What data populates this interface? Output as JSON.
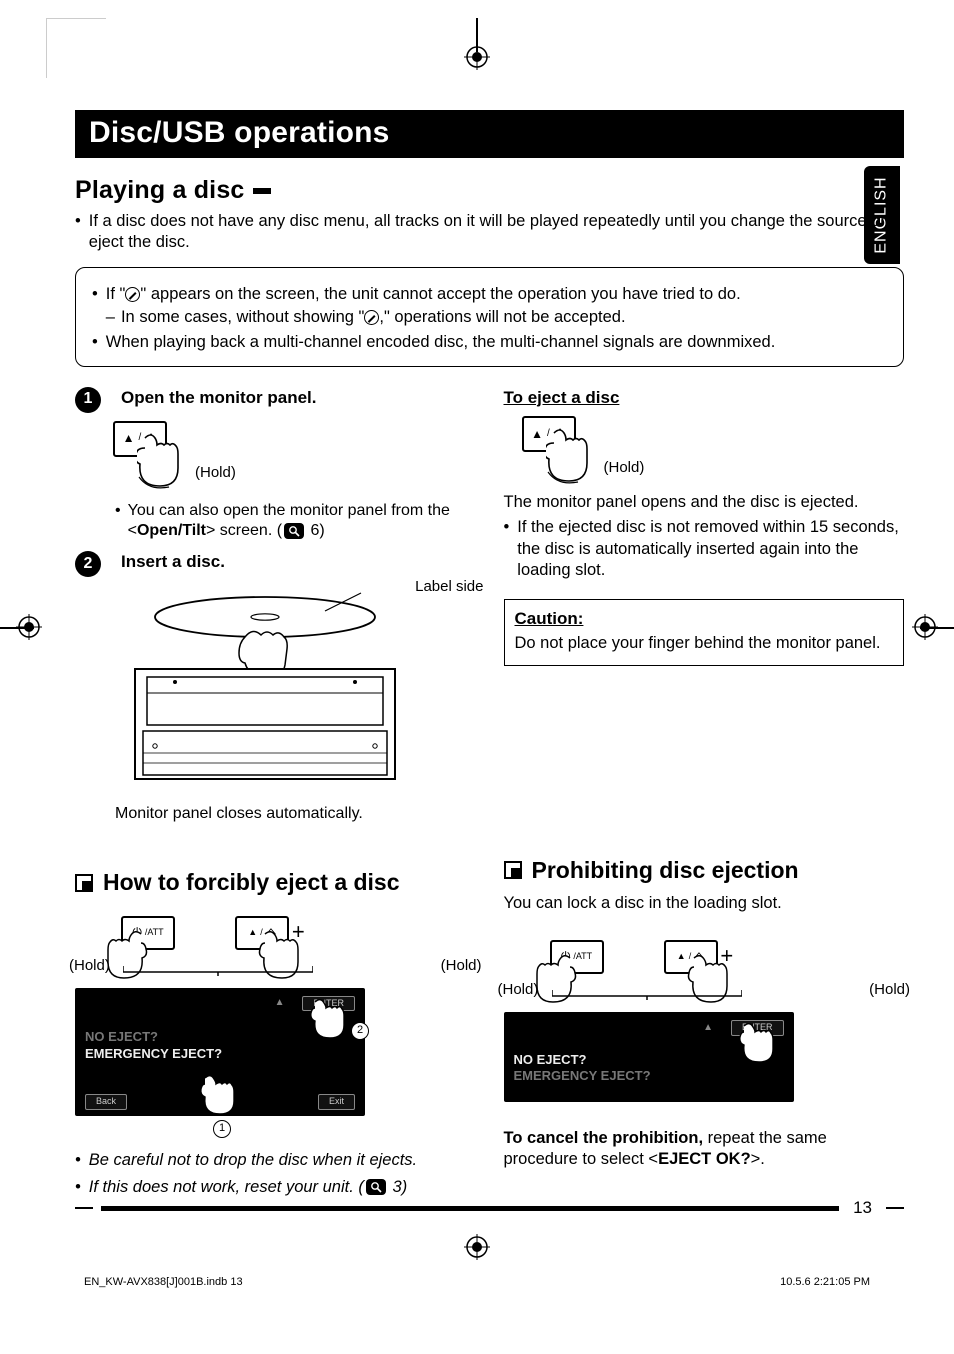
{
  "side_tab": "ENGLISH",
  "title_bar": "Disc/USB operations",
  "section1": {
    "heading": "Playing a disc",
    "bullet1": "If a disc does not have any disc menu, all tracks on it will be played repeatedly until you change the source or eject the disc.",
    "box": {
      "b1_pre": "If \"",
      "b1_post": "\" appears on the screen, the unit cannot accept the operation you have tried to do.",
      "b1_sub_pre": "In some cases, without showing \"",
      "b1_sub_post": ",\" operations will not be accepted.",
      "b2": "When playing back a multi-channel encoded disc, the multi-channel signals are downmixed."
    }
  },
  "steps": {
    "s1_title": "Open the monitor panel.",
    "hold": "(Hold)",
    "s1_note_pre": "You can also open the monitor panel from the <",
    "s1_note_bold": "Open/Tilt",
    "s1_note_post": "> screen. (",
    "s1_note_ref": "6",
    "s1_note_close": ")",
    "s2_title": "Insert a disc.",
    "label_side": "Label side",
    "s2_caption": "Monitor panel closes automatically."
  },
  "eject": {
    "heading": "To eject a disc",
    "hold": "(Hold)",
    "line1": "The monitor panel opens and the disc is ejected.",
    "bullet": "If the ejected disc is not removed within 15 seconds, the disc is automatically inserted again into the loading slot.",
    "caution_h": "Caution:",
    "caution_t": "Do not place your finger behind the monitor panel."
  },
  "force": {
    "heading": "How to forcibly eject a disc",
    "hold": "(Hold)",
    "btn_att": "/ATT",
    "screen": {
      "enter": "ENTER",
      "q1": "NO EJECT?",
      "q2": "EMERGENCY EJECT?",
      "back": "Back",
      "exit": "Exit"
    },
    "note1": "Be careful not to drop the disc when it ejects.",
    "note2_pre": "If this does not work, reset your unit. (",
    "note2_ref": "3",
    "note2_post": ")"
  },
  "prohibit": {
    "heading": "Prohibiting disc ejection",
    "intro": "You can lock a disc in the loading slot.",
    "hold": "(Hold)",
    "screen": {
      "enter": "ENTER",
      "q1": "NO EJECT?",
      "q2": "EMERGENCY EJECT?"
    },
    "cancel_b": "To cancel the prohibition,",
    "cancel_rest_pre": " repeat the same procedure to select <",
    "cancel_bold": "EJECT OK?",
    "cancel_rest_post": ">."
  },
  "page_number": "13",
  "footer_left": "EN_KW-AVX838[J]001B.indb   13",
  "footer_right": "10.5.6   2:21:05 PM"
}
